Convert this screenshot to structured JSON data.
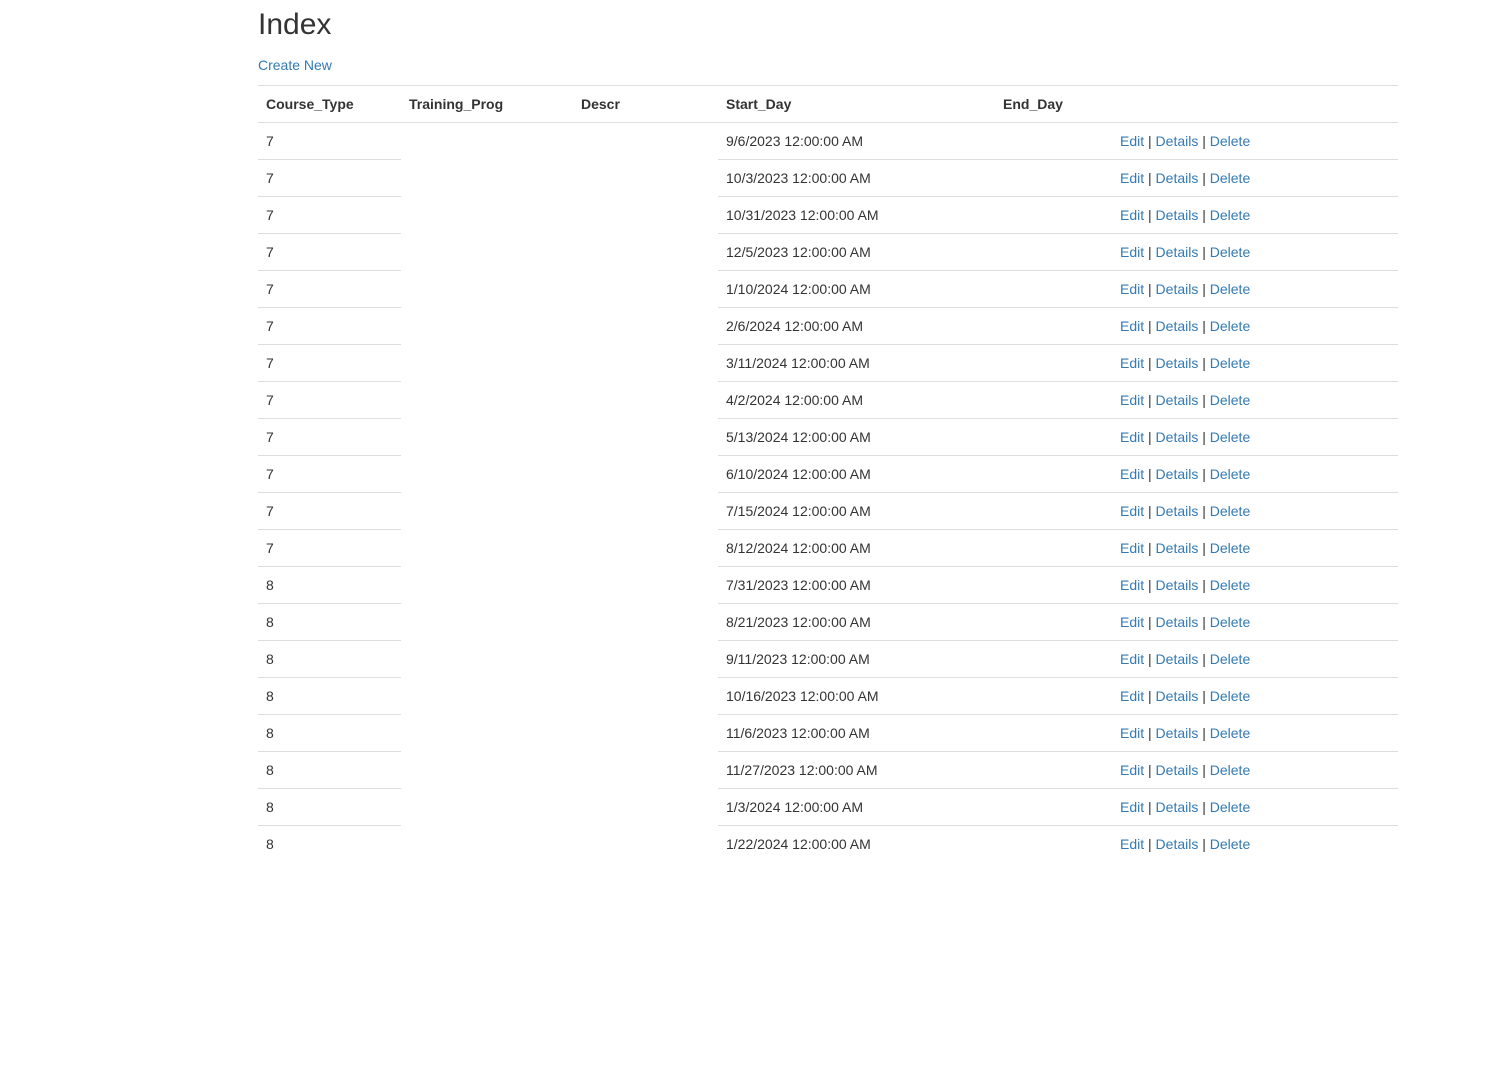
{
  "page": {
    "title": "Index",
    "create_link": "Create New"
  },
  "table": {
    "headers": [
      "Course_Type",
      "Training_Prog",
      "Descr",
      "Start_Day",
      "End_Day"
    ],
    "actions": {
      "edit": "Edit",
      "details": "Details",
      "delete": "Delete",
      "separator": "|"
    },
    "rows": [
      {
        "course_type": "7",
        "training_prog": "",
        "descr": "",
        "start_day": "9/6/2023 12:00:00 AM",
        "end_day": ""
      },
      {
        "course_type": "7",
        "training_prog": "",
        "descr": "",
        "start_day": "10/3/2023 12:00:00 AM",
        "end_day": ""
      },
      {
        "course_type": "7",
        "training_prog": "",
        "descr": "",
        "start_day": "10/31/2023 12:00:00 AM",
        "end_day": ""
      },
      {
        "course_type": "7",
        "training_prog": "",
        "descr": "",
        "start_day": "12/5/2023 12:00:00 AM",
        "end_day": ""
      },
      {
        "course_type": "7",
        "training_prog": "",
        "descr": "",
        "start_day": "1/10/2024 12:00:00 AM",
        "end_day": ""
      },
      {
        "course_type": "7",
        "training_prog": "",
        "descr": "",
        "start_day": "2/6/2024 12:00:00 AM",
        "end_day": ""
      },
      {
        "course_type": "7",
        "training_prog": "",
        "descr": "",
        "start_day": "3/11/2024 12:00:00 AM",
        "end_day": ""
      },
      {
        "course_type": "7",
        "training_prog": "",
        "descr": "",
        "start_day": "4/2/2024 12:00:00 AM",
        "end_day": ""
      },
      {
        "course_type": "7",
        "training_prog": "",
        "descr": "",
        "start_day": "5/13/2024 12:00:00 AM",
        "end_day": ""
      },
      {
        "course_type": "7",
        "training_prog": "",
        "descr": "",
        "start_day": "6/10/2024 12:00:00 AM",
        "end_day": ""
      },
      {
        "course_type": "7",
        "training_prog": "",
        "descr": "",
        "start_day": "7/15/2024 12:00:00 AM",
        "end_day": ""
      },
      {
        "course_type": "7",
        "training_prog": "",
        "descr": "",
        "start_day": "8/12/2024 12:00:00 AM",
        "end_day": ""
      },
      {
        "course_type": "8",
        "training_prog": "",
        "descr": "",
        "start_day": "7/31/2023 12:00:00 AM",
        "end_day": ""
      },
      {
        "course_type": "8",
        "training_prog": "",
        "descr": "",
        "start_day": "8/21/2023 12:00:00 AM",
        "end_day": ""
      },
      {
        "course_type": "8",
        "training_prog": "",
        "descr": "",
        "start_day": "9/11/2023 12:00:00 AM",
        "end_day": ""
      },
      {
        "course_type": "8",
        "training_prog": "",
        "descr": "",
        "start_day": "10/16/2023 12:00:00 AM",
        "end_day": ""
      },
      {
        "course_type": "8",
        "training_prog": "",
        "descr": "",
        "start_day": "11/6/2023 12:00:00 AM",
        "end_day": ""
      },
      {
        "course_type": "8",
        "training_prog": "",
        "descr": "",
        "start_day": "11/27/2023 12:00:00 AM",
        "end_day": ""
      },
      {
        "course_type": "8",
        "training_prog": "",
        "descr": "",
        "start_day": "1/3/2024 12:00:00 AM",
        "end_day": ""
      },
      {
        "course_type": "8",
        "training_prog": "",
        "descr": "",
        "start_day": "1/22/2024 12:00:00 AM",
        "end_day": ""
      }
    ]
  }
}
